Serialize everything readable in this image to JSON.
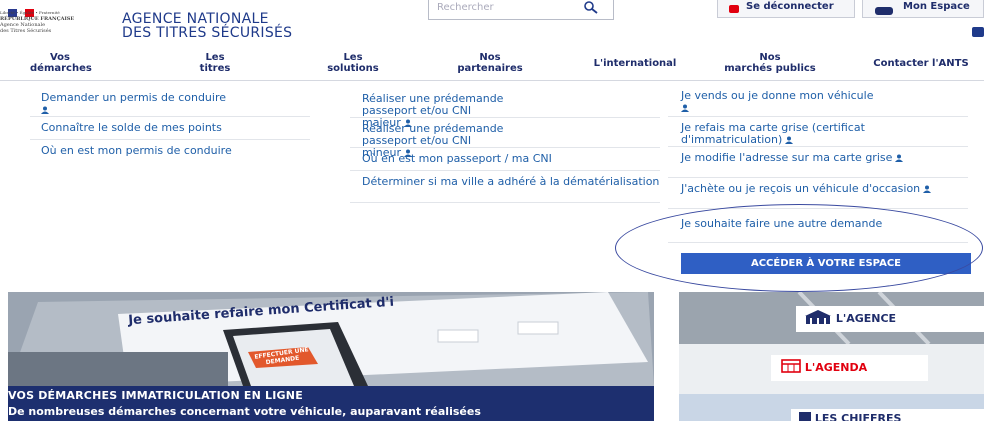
{
  "header": {
    "logo_lines": [
      "Liberté • Égalité • Fraternité",
      "RÉPUBLIQUE FRANÇAISE",
      "Agence Nationale",
      "des Titres Sécurisés"
    ],
    "agency_name_line1": "AGENCE NATIONALE",
    "agency_name_line2": "DES TITRES SÉCURISÉS",
    "search_placeholder": "Rechercher",
    "logout_label": "Se déconnecter",
    "my_space_label": "Mon Espace",
    "colors": {
      "brand_blue": "#1f3a8a",
      "flag_blue": "#2a3a8f",
      "flag_red": "#e1000f"
    }
  },
  "nav": {
    "items": [
      {
        "line1": "Vos",
        "line2": "démarches"
      },
      {
        "line1": "Les",
        "line2": "titres"
      },
      {
        "line1": "Les",
        "line2": "solutions"
      },
      {
        "line1": "Nos",
        "line2": "partenaires"
      },
      {
        "line1": "L'international",
        "line2": ""
      },
      {
        "line1": "Nos",
        "line2": "marchés publics"
      },
      {
        "line1": "Contacter l'ANTS",
        "line2": ""
      }
    ]
  },
  "menu": {
    "col1": [
      "Demander un permis de conduire",
      "Connaître le solde de mes points",
      "Où en est mon permis de conduire"
    ],
    "col2": [
      "Réaliser une prédemande passeport et/ou CNI majeur",
      "Réaliser une prédemande passeport et/ou CNI mineur",
      "Où en est mon passeport / ma CNI",
      "Déterminer si ma ville a adhéré à la dématérialisation"
    ],
    "col3": [
      "Je vends ou je donne mon véhicule",
      "Je refais ma carte grise (certificat d'immatriculation)",
      "Je modifie l'adresse sur ma carte grise",
      "J'achète ou je reçois un véhicule d'occasion",
      "Je souhaite faire une autre demande"
    ],
    "cta_label": "ACCÉDER À VOTRE ESPACE"
  },
  "banner": {
    "screen_title": "Je souhaite refaire mon Certificat d'i",
    "phone_button": "EFFECTUER UNE DEMANDE",
    "heading": "VOS DÉMARCHES IMMATRICULATION EN LIGNE",
    "text": "De nombreuses démarches concernant votre véhicule, auparavant réalisées"
  },
  "side": {
    "agence_label": "L'AGENCE",
    "agenda_label": "L'AGENDA",
    "chiffres_label": "LES CHIFFRES"
  }
}
